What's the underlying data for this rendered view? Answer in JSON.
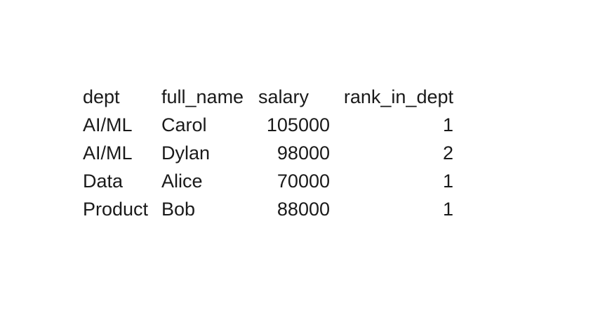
{
  "table": {
    "columns": [
      "dept",
      "full_name",
      "salary",
      "rank_in_dept"
    ],
    "rows": [
      {
        "dept": "AI/ML",
        "full_name": "Carol",
        "salary": "105000",
        "rank_in_dept": "1"
      },
      {
        "dept": "AI/ML",
        "full_name": "Dylan",
        "salary": "98000",
        "rank_in_dept": "2"
      },
      {
        "dept": "Data",
        "full_name": "Alice",
        "salary": "70000",
        "rank_in_dept": "1"
      },
      {
        "dept": "Product",
        "full_name": "Bob",
        "salary": "88000",
        "rank_in_dept": "1"
      }
    ]
  }
}
